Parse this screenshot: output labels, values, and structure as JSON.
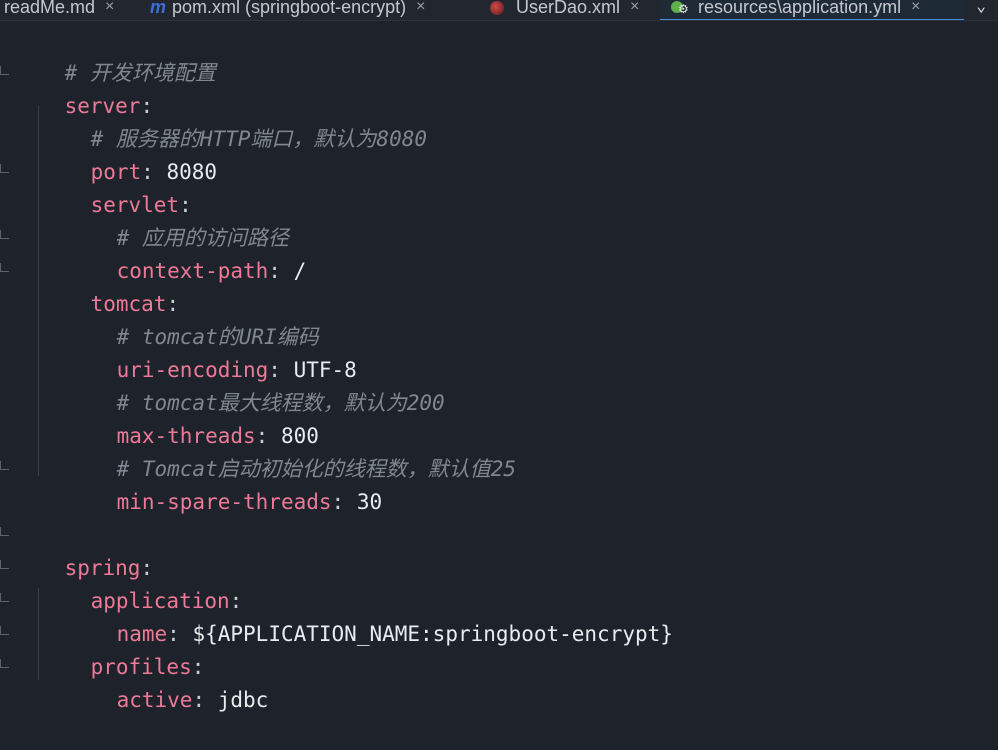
{
  "tabs": [
    {
      "label": "readMe.md",
      "icon": "markdown-icon",
      "active": false
    },
    {
      "label": "pom.xml (springboot-encrypt)",
      "icon": "maven-icon",
      "active": false
    },
    {
      "label": "UserDao.xml",
      "icon": "xml-mapper-icon",
      "active": false
    },
    {
      "label": "resources\\application.yml",
      "icon": "spring-yaml-icon",
      "active": true
    }
  ],
  "tab_close_glyph": "×",
  "tab_menu_glyph": "⌄",
  "editor": {
    "lines": {
      "l1": {
        "comment": "# 开发环境配置"
      },
      "l2": {
        "key": "server",
        "colon": ":"
      },
      "l3": {
        "comment": "# 服务器的HTTP端口，默认为8080"
      },
      "l4": {
        "key": "port",
        "colon": ":",
        "value": "8080"
      },
      "l5": {
        "key": "servlet",
        "colon": ":"
      },
      "l6": {
        "comment": "# 应用的访问路径"
      },
      "l7": {
        "key": "context-path",
        "colon": ":",
        "value": "/"
      },
      "l8": {
        "key": "tomcat",
        "colon": ":"
      },
      "l9": {
        "comment": "# tomcat的URI编码"
      },
      "l10": {
        "key": "uri-encoding",
        "colon": ":",
        "value": "UTF-8"
      },
      "l11": {
        "comment": "# tomcat最大线程数，默认为200"
      },
      "l12": {
        "key": "max-threads",
        "colon": ":",
        "value": "800"
      },
      "l13": {
        "comment": "# Tomcat启动初始化的线程数，默认值25"
      },
      "l14": {
        "key": "min-spare-threads",
        "colon": ":",
        "value": "30"
      },
      "l16": {
        "key": "spring",
        "colon": ":"
      },
      "l17": {
        "key": "application",
        "colon": ":"
      },
      "l18": {
        "key": "name",
        "colon": ":",
        "value": "${APPLICATION_NAME:springboot-encrypt}"
      },
      "l19": {
        "key": "profiles",
        "colon": ":"
      },
      "l20": {
        "key": "active",
        "colon": ":",
        "value": "jdbc"
      }
    }
  },
  "colors": {
    "background": "#1e232b",
    "key": "#ee7997",
    "comment": "#7f8790",
    "value": "#e9ecef",
    "active_tab_underline": "#4a8cd8"
  }
}
